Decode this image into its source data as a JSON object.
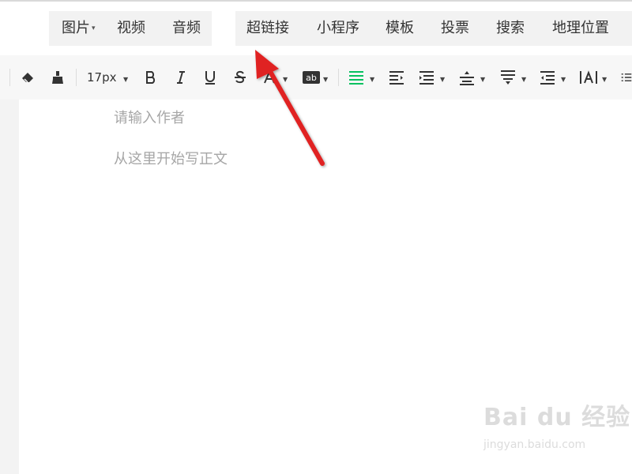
{
  "insert_bar": {
    "image": "图片",
    "video": "视频",
    "audio": "音频",
    "hyperlink": "超链接",
    "mini_program": "小程序",
    "template": "模板",
    "vote": "投票",
    "search": "搜索",
    "location": "地理位置"
  },
  "toolbar": {
    "font_size": "17px",
    "active_color": "#07c160"
  },
  "editor": {
    "author_placeholder": "请输入作者",
    "body_placeholder": "从这里开始写正文"
  },
  "annotation": {
    "arrow_color": "#e02020"
  },
  "watermark": {
    "brand": "Bai du 经验",
    "url": "jingyan.baidu.com"
  }
}
